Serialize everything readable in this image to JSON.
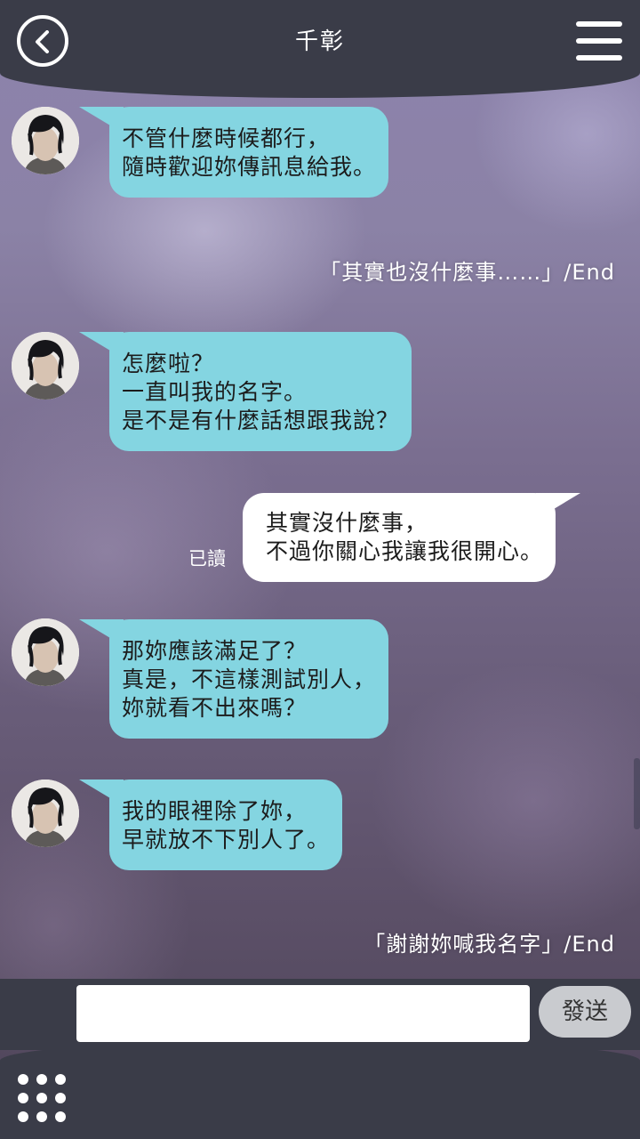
{
  "header": {
    "title": "千彰",
    "back_icon": "chevron-left-icon",
    "menu_icon": "hamburger-menu-icon"
  },
  "messages": [
    {
      "type": "incoming",
      "lines": [
        "不管什麼時候都行，",
        "隨時歡迎妳傳訊息給我。"
      ]
    },
    {
      "type": "choice",
      "text": "「其實也沒什麼事……」/End"
    },
    {
      "type": "incoming",
      "lines": [
        "怎麼啦？",
        "一直叫我的名字。",
        "是不是有什麼話想跟我說？"
      ]
    },
    {
      "type": "outgoing",
      "lines": [
        "其實沒什麼事，",
        "不過你關心我讓我很開心。"
      ],
      "status": "已讀"
    },
    {
      "type": "incoming",
      "lines": [
        "那妳應該滿足了？",
        "真是，不這樣測試別人，",
        "妳就看不出來嗎？"
      ]
    },
    {
      "type": "incoming",
      "lines": [
        "我的眼裡除了妳，",
        "早就放不下別人了。"
      ]
    },
    {
      "type": "choice",
      "text": "「謝謝妳喊我名字」/End"
    }
  ],
  "composer": {
    "input_value": "",
    "send_label": "發送"
  },
  "footer": {
    "grid_icon": "grid-dots-icon"
  },
  "colors": {
    "bar": "#3a3c48",
    "incoming_bubble": "#84d5e1",
    "outgoing_bubble": "#ffffff",
    "send_button": "#c9cbcf"
  }
}
